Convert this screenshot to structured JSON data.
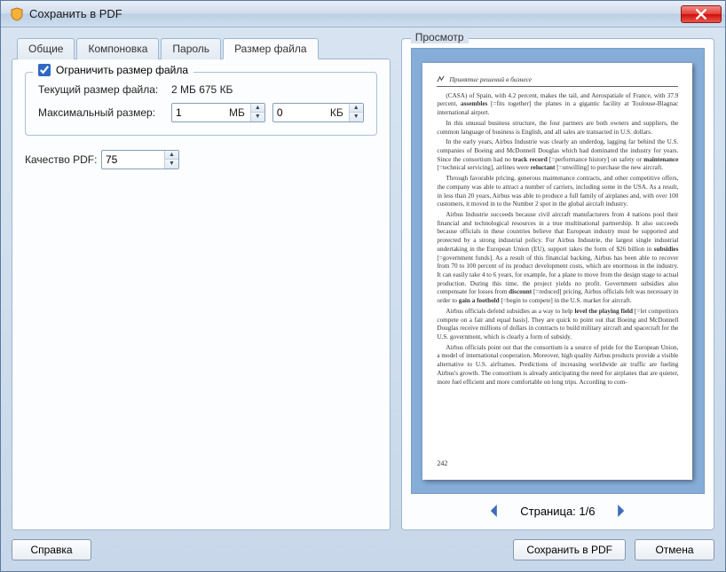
{
  "window": {
    "title": "Сохранить в PDF"
  },
  "tabs": {
    "common": "Общие",
    "layout": "Компоновка",
    "password": "Пароль",
    "filesize": "Размер файла"
  },
  "limit": {
    "checkbox_label": "Ограничить размер файла",
    "checked": true,
    "current_label": "Текущий размер файла:",
    "current_value": "2 МБ 675 КБ",
    "max_label": "Максимальный размер:",
    "mb_value": "1",
    "mb_unit": "МБ",
    "kb_value": "0",
    "kb_unit": "КБ"
  },
  "quality": {
    "label": "Качество PDF:",
    "value": "75"
  },
  "preview": {
    "title": "Просмотр",
    "page_header": "Принятие решений в бизнесе",
    "page_number": "242",
    "pager_label": "Страница:",
    "pager_value": "1/6"
  },
  "buttons": {
    "help": "Справка",
    "save": "Сохранить в PDF",
    "cancel": "Отмена"
  }
}
